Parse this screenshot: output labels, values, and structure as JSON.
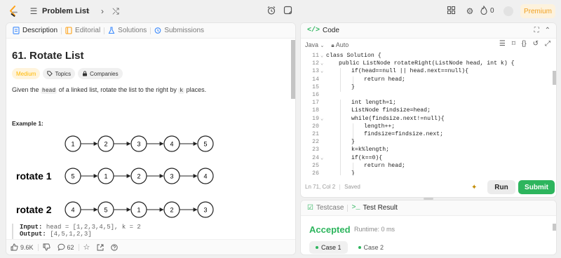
{
  "colors": {
    "accent": "#ffa116",
    "green": "#2db55d",
    "premium": "#f0a020",
    "medium": "#ffb800"
  },
  "topbar": {
    "problem_list_label": "Problem List",
    "coins": "0",
    "premium_label": "Premium"
  },
  "left": {
    "tabs": [
      {
        "label": "Description",
        "icon": "document-icon"
      },
      {
        "label": "Editorial",
        "icon": "book-icon"
      },
      {
        "label": "Solutions",
        "icon": "flask-icon"
      },
      {
        "label": "Submissions",
        "icon": "history-icon"
      }
    ],
    "title": "61. Rotate List",
    "difficulty": "Medium",
    "topics_label": "Topics",
    "companies_label": "Companies",
    "desc_before": "Given the ",
    "desc_code1": "head",
    "desc_mid": " of a linked list, rotate the list to the right by ",
    "desc_code2": "k",
    "desc_after": " places.",
    "example_label": "Example 1:",
    "figure": {
      "rows": [
        {
          "label": "",
          "nodes": [
            "1",
            "2",
            "3",
            "4",
            "5"
          ]
        },
        {
          "label": "rotate 1",
          "nodes": [
            "5",
            "1",
            "2",
            "3",
            "4"
          ]
        },
        {
          "label": "rotate 2",
          "nodes": [
            "4",
            "5",
            "1",
            "2",
            "3"
          ]
        }
      ]
    },
    "input_label": "Input:",
    "input_value": "head = [1,2,3,4,5], k = 2",
    "output_label": "Output:",
    "output_value": "[4,5,1,2,3]",
    "footer": {
      "likes": "9.6K",
      "comments": "62"
    }
  },
  "code": {
    "tab_label": "Code",
    "language": "Java",
    "mode": "Auto",
    "lines": [
      {
        "n": "11",
        "fold": true,
        "indent": 0,
        "text": "class Solution {"
      },
      {
        "n": "12",
        "fold": true,
        "indent": 1,
        "text": "public ListNode rotateRight(ListNode head, int k) {"
      },
      {
        "n": "13",
        "fold": true,
        "indent": 2,
        "text": "if(head==null || head.next==null){"
      },
      {
        "n": "14",
        "fold": false,
        "indent": 3,
        "text": "return head;"
      },
      {
        "n": "15",
        "fold": false,
        "indent": 2,
        "text": "}"
      },
      {
        "n": "16",
        "fold": false,
        "indent": 0,
        "text": ""
      },
      {
        "n": "17",
        "fold": false,
        "indent": 2,
        "text": "int length=1;"
      },
      {
        "n": "18",
        "fold": false,
        "indent": 2,
        "text": "ListNode findsize=head;"
      },
      {
        "n": "19",
        "fold": true,
        "indent": 2,
        "text": "while(findsize.next!=null){"
      },
      {
        "n": "20",
        "fold": false,
        "indent": 3,
        "text": "length++;"
      },
      {
        "n": "21",
        "fold": false,
        "indent": 3,
        "text": "findsize=findsize.next;"
      },
      {
        "n": "22",
        "fold": false,
        "indent": 2,
        "text": "}"
      },
      {
        "n": "23",
        "fold": false,
        "indent": 2,
        "text": "k=k%length;"
      },
      {
        "n": "24",
        "fold": true,
        "indent": 2,
        "text": "if(k==0){"
      },
      {
        "n": "25",
        "fold": false,
        "indent": 3,
        "text": "return head;"
      },
      {
        "n": "26",
        "fold": false,
        "indent": 2,
        "text": "}"
      }
    ],
    "status": "Ln 71, Col 2",
    "saved": "Saved",
    "run_label": "Run",
    "submit_label": "Submit"
  },
  "test": {
    "testcase_label": "Testcase",
    "result_label": "Test Result",
    "verdict": "Accepted",
    "runtime": "Runtime: 0 ms",
    "cases": [
      "Case 1",
      "Case 2"
    ]
  }
}
